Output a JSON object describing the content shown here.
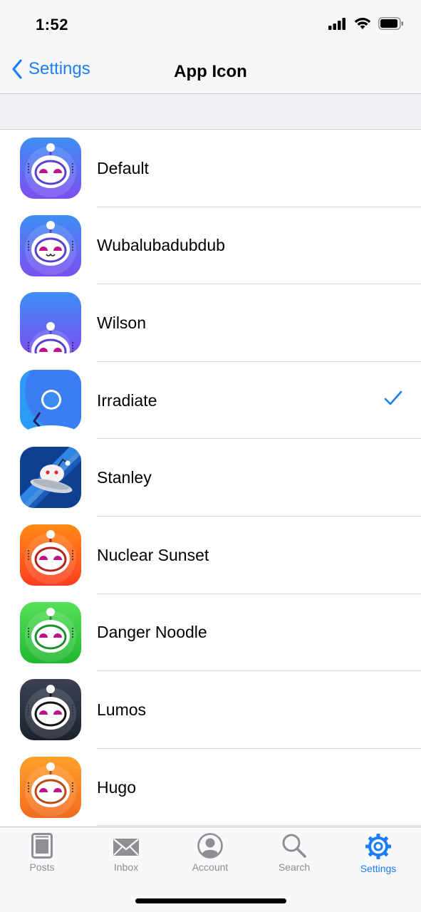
{
  "status": {
    "time": "1:52"
  },
  "nav": {
    "back_label": "Settings",
    "title": "App Icon"
  },
  "icons": [
    {
      "name": "Default",
      "bg1": "#3d8ff5",
      "bg2": "#7b4ff0",
      "ring": "#5b3fd0",
      "selected": false
    },
    {
      "name": "Wubalubadubdub",
      "bg1": "#3d8ff5",
      "bg2": "#7b4ff0",
      "ring": "#5b3fd0",
      "selected": false
    },
    {
      "name": "Wilson",
      "bg1": "#3d8ff5",
      "bg2": "#7b4ff0",
      "ring": "#5b3fd0",
      "selected": false
    },
    {
      "name": "Irradiate",
      "bg1": "#2b9bf7",
      "bg2": "#5a45e8",
      "ring": "#3a2a80",
      "selected": true
    },
    {
      "name": "Stanley",
      "bg1": "#1b63c9",
      "bg2": "#0f3f8f",
      "ring": "#ffffff",
      "selected": false
    },
    {
      "name": "Nuclear Sunset",
      "bg1": "#ff8a16",
      "bg2": "#ff3d1f",
      "ring": "#b5231a",
      "selected": false
    },
    {
      "name": "Danger Noodle",
      "bg1": "#57e05a",
      "bg2": "#1fb82f",
      "ring": "#1d8f2a",
      "selected": false
    },
    {
      "name": "Lumos",
      "bg1": "#3c4253",
      "bg2": "#1d2230",
      "ring": "#111318",
      "selected": false
    },
    {
      "name": "Hugo",
      "bg1": "#ffa02a",
      "bg2": "#f26b1f",
      "ring": "#b84a12",
      "selected": false
    }
  ],
  "tabs": [
    {
      "label": "Posts",
      "icon": "posts-icon",
      "active": false
    },
    {
      "label": "Inbox",
      "icon": "inbox-icon",
      "active": false
    },
    {
      "label": "Account",
      "icon": "account-icon",
      "active": false
    },
    {
      "label": "Search",
      "icon": "search-icon",
      "active": false
    },
    {
      "label": "Settings",
      "icon": "gear-icon",
      "active": true
    }
  ],
  "colors": {
    "accent": "#1a7ef5",
    "inactive": "#8e8e93"
  }
}
